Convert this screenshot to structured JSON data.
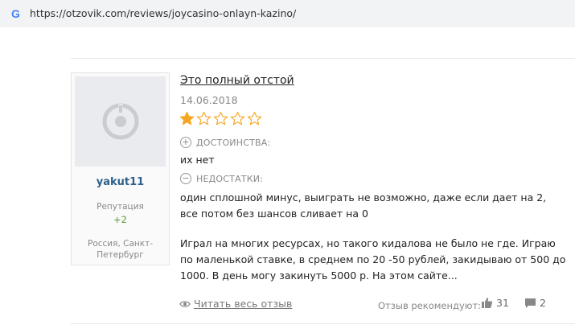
{
  "browser": {
    "url": "https://otzovik.com/reviews/joycasino-onlayn-kazino/"
  },
  "author": {
    "username": "yakut11",
    "reputation_label": "Репутация",
    "reputation_value": "+2",
    "location_line1": "Россия, Санкт-",
    "location_line2": "Петербург"
  },
  "review": {
    "title": "Это полный отстой",
    "date": "14.06.2018",
    "rating": 1,
    "rating_max": 5,
    "pros_label": "ДОСТОИНСТВА:",
    "pros_text": "их нет",
    "cons_label": "НЕДОСТАТКИ:",
    "cons_text": "один сплошной минус, выиграть не возможно, даже если дает на 2, все потом без шансов сливает на 0",
    "body_text": "Играл на многих ресурсах, но такого кидалова не было не где. Играю по маленькой ставке, в среднем по 20 -50 рублей, закидываю от 500 до 1000. В день могу закинуть 5000 р. На этом сайте..."
  },
  "footer": {
    "read_more": "Читать весь отзыв",
    "recommend_label": "Отзыв рекомендуют:",
    "likes": "31",
    "comments": "2"
  },
  "colors": {
    "star_filled": "#f5a623",
    "star_empty": "#f5a623",
    "username": "#2d5f8b",
    "reputation": "#5a9b3a"
  },
  "icons": {
    "browser": "google-g-icon",
    "avatar": "default-avatar-icon",
    "pros": "plus-circle-icon",
    "cons": "minus-circle-icon",
    "read_more": "eye-icon",
    "likes": "thumbs-up-icon",
    "comments": "comment-icon"
  }
}
